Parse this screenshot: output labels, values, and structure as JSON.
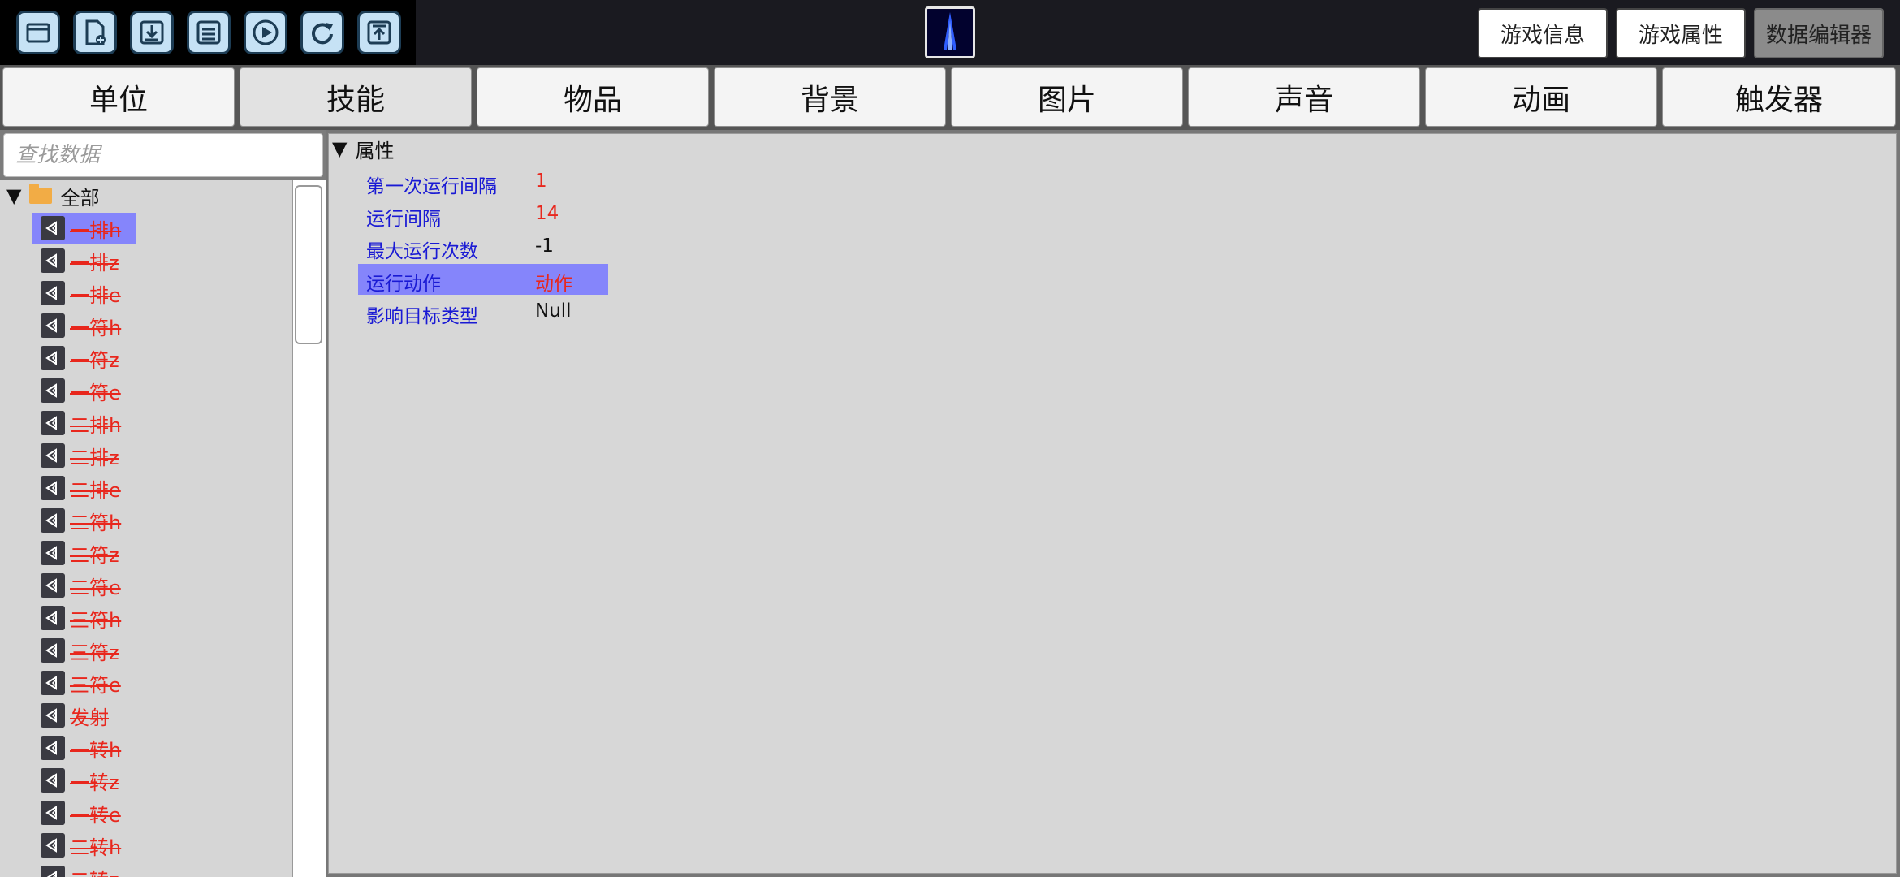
{
  "toolbar": {
    "icons": [
      "open-folder-icon",
      "new-file-icon",
      "download-icon",
      "save-icon",
      "play-icon",
      "refresh-icon",
      "upload-icon"
    ]
  },
  "header_buttons": {
    "game_info": "游戏信息",
    "game_properties": "游戏属性",
    "data_editor": "数据编辑器"
  },
  "tabs": [
    {
      "label": "单位"
    },
    {
      "label": "技能"
    },
    {
      "label": "物品"
    },
    {
      "label": "背景"
    },
    {
      "label": "图片"
    },
    {
      "label": "声音"
    },
    {
      "label": "动画"
    },
    {
      "label": "触发器"
    }
  ],
  "search": {
    "placeholder": "查找数据",
    "value": ""
  },
  "tree": {
    "root_label": "全部",
    "items": [
      {
        "label": "一排h"
      },
      {
        "label": "一排z"
      },
      {
        "label": "一排e"
      },
      {
        "label": "一符h"
      },
      {
        "label": "一符z"
      },
      {
        "label": "一符e"
      },
      {
        "label": "二排h"
      },
      {
        "label": "二排z"
      },
      {
        "label": "二排e"
      },
      {
        "label": "二符h"
      },
      {
        "label": "二符z"
      },
      {
        "label": "二符e"
      },
      {
        "label": "三符h"
      },
      {
        "label": "三符z"
      },
      {
        "label": "三符e"
      },
      {
        "label": "发射"
      },
      {
        "label": "一转h"
      },
      {
        "label": "一转z"
      },
      {
        "label": "一转e"
      },
      {
        "label": "二转h"
      },
      {
        "label": "二转z"
      }
    ]
  },
  "properties": {
    "header": "属性",
    "rows": [
      {
        "name": "第一次运行间隔",
        "value": "1"
      },
      {
        "name": "运行间隔",
        "value": "14"
      },
      {
        "name": "最大运行次数",
        "value": "-1"
      },
      {
        "name": "运行动作",
        "value": "动作"
      },
      {
        "name": "影响目标类型",
        "value": "Null"
      }
    ]
  },
  "colors": {
    "selection": "#8585fb",
    "item_text": "#e8271d",
    "property_name": "#1a1ad4"
  }
}
